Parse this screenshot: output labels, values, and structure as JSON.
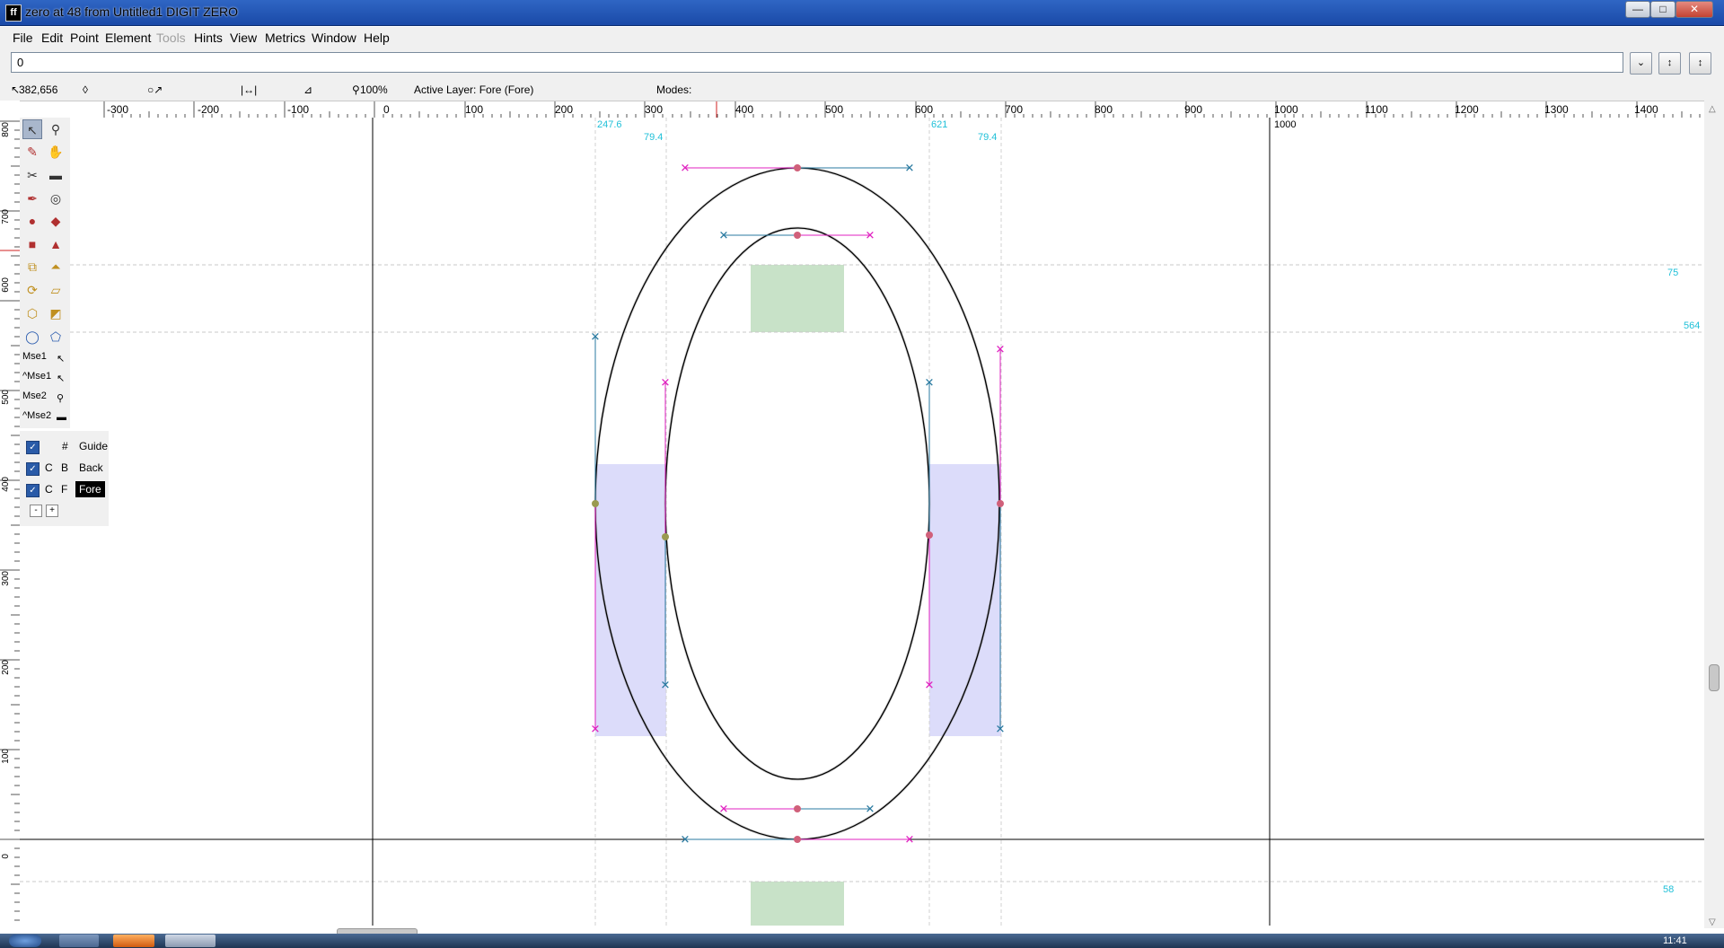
{
  "window": {
    "title": "zero at 48 from Untitled1 DIGIT ZERO",
    "app_icon": "fontforge-icon",
    "controls": [
      "minimize",
      "maximize",
      "close"
    ]
  },
  "menubar": {
    "items": [
      {
        "label": "File",
        "enabled": true
      },
      {
        "label": "Edit",
        "enabled": true
      },
      {
        "label": "Point",
        "enabled": true
      },
      {
        "label": "Element",
        "enabled": true
      },
      {
        "label": "Tools",
        "enabled": false
      },
      {
        "label": "Hints",
        "enabled": true
      },
      {
        "label": "View",
        "enabled": true
      },
      {
        "label": "Metrics",
        "enabled": true
      },
      {
        "label": "Window",
        "enabled": true
      },
      {
        "label": "Help",
        "enabled": true
      }
    ]
  },
  "char_input": {
    "value": "0"
  },
  "status": {
    "coords": "382,656",
    "zoom": "100%",
    "active_layer": "Active Layer: Fore (Fore)",
    "modes": "Modes:"
  },
  "hruler": {
    "ticks": [
      "-300",
      "-200",
      "-100",
      "0",
      "100",
      "200",
      "300",
      "400",
      "500",
      "600",
      "700",
      "800",
      "900",
      "1000",
      "1100",
      "1200",
      "1300",
      "1400"
    ]
  },
  "vruler": {
    "ticks": [
      "800",
      "700",
      "600",
      "500",
      "400",
      "300",
      "200",
      "100",
      "0"
    ]
  },
  "canvas_labels": {
    "x_left": "247.6",
    "width_left": "79.4",
    "x_right": "621",
    "width_right": "79.4",
    "advance_width": "1000",
    "hint_top_width": "75",
    "hint_top_pos": "564",
    "hint_bottom_width": "58"
  },
  "toolbox": {
    "tools": [
      "pointer-icon",
      "magnify-icon",
      "pencil-icon",
      "hand-icon",
      "knife-icon",
      "ruler-icon",
      "pen-icon",
      "spiro-icon",
      "curve-point-icon",
      "hv-curve-point-icon",
      "corner-point-icon",
      "tangent-point-icon",
      "scale-icon",
      "flip-icon",
      "rotate-icon",
      "skew-icon",
      "perspective-3d-icon",
      "perspective-icon",
      "ellipse-icon",
      "polygon-icon"
    ],
    "mouse": [
      {
        "label": "Mse1",
        "icon": "pointer-icon"
      },
      {
        "label": "^Mse1",
        "icon": "pointer-icon"
      },
      {
        "label": "Mse2",
        "icon": "magnify-icon"
      },
      {
        "label": "^Mse2",
        "icon": "ruler-icon"
      }
    ]
  },
  "layers": {
    "rows": [
      {
        "c": "",
        "type": "#",
        "name": "Guide",
        "checked": true,
        "selected": false
      },
      {
        "c": "C",
        "type": "B",
        "name": "Back",
        "checked": true,
        "selected": false
      },
      {
        "c": "C",
        "type": "F",
        "name": "Fore",
        "checked": true,
        "selected": true
      }
    ],
    "remove_label": "-",
    "add_label": "+"
  },
  "taskbar": {
    "clock": "11:41"
  },
  "colors": {
    "hint_horizontal": "#c8e2c8",
    "hint_vertical": "#dcdcfa",
    "control_magenta": "#e020c0",
    "control_teal": "#2a7aa0",
    "metric_cyan": "#20c0d8",
    "oncurve_point": "#d0607a"
  }
}
